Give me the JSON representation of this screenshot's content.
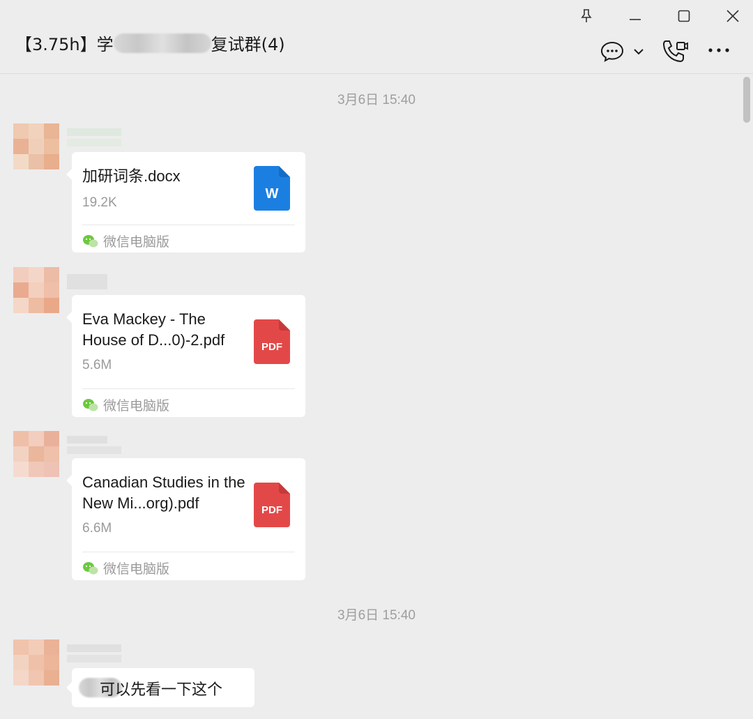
{
  "header": {
    "title_prefix": "【3.75h】学",
    "title_suffix": "复试群(4)",
    "pin_icon": "pin-icon",
    "minimize_icon": "minimize-icon",
    "maximize_icon": "maximize-icon",
    "close_icon": "close-icon",
    "chat_icon": "chat-bubble-icon",
    "call_icon": "phone-video-icon",
    "more_icon": "more-icon"
  },
  "timestamps": [
    "3月6日 15:40",
    "3月6日 15:40"
  ],
  "messages": [
    {
      "file_name": "加研词条.docx",
      "file_size": "19.2K",
      "file_type": "W",
      "file_color": "#1b7fe2",
      "source": "微信电脑版"
    },
    {
      "file_name": "Eva Mackey - The House of D...0)-2.pdf",
      "file_size": "5.6M",
      "file_type": "PDF",
      "file_color": "#e34848",
      "source": "微信电脑版"
    },
    {
      "file_name": "Canadian Studies in the New Mi...org).pdf",
      "file_size": "6.6M",
      "file_type": "PDF",
      "file_color": "#e34848",
      "source": "微信电脑版"
    }
  ],
  "text_message": {
    "text": "可以先看一下这个"
  }
}
